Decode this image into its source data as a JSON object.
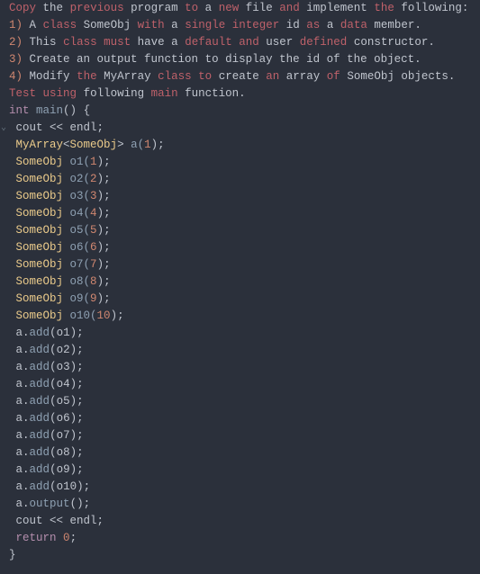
{
  "comment": {
    "line1": {
      "copy": "Copy",
      "the1": "the",
      "previous": "previous",
      "program": "program",
      "to": "to",
      "a1": "a",
      "new": "new",
      "file": "file",
      "and": "and",
      "implement": "implement",
      "the2": "the",
      "following": "following:"
    },
    "line2": {
      "num": "1)",
      "a": "A",
      "class": "class",
      "someobj": "SomeObj",
      "with": "with",
      "a2": "a",
      "single": "single",
      "integer": "integer",
      "id": "id",
      "as": "as",
      "a3": "a",
      "data": "data",
      "member": "member."
    },
    "line3": {
      "num": "2)",
      "this": "This",
      "class": "class",
      "must": "must",
      "have": "have",
      "a": "a",
      "default": "default",
      "and": "and",
      "user": "user",
      "defined": "defined",
      "constructor": "constructor."
    },
    "line4": {
      "num": "3)",
      "rest": "Create an output function to display the id of the object."
    },
    "line5": {
      "num": "4)",
      "modify": "Modify",
      "the": "the",
      "myarray": "MyArray",
      "class": "class",
      "to": "to",
      "create": "create",
      "an": "an",
      "array": "array",
      "of": "of",
      "someobj": "SomeObj",
      "objects": "objects."
    },
    "line6": {
      "test": "Test",
      "using": "using",
      "following": "following",
      "main": "main",
      "function": "function."
    }
  },
  "code": {
    "int": "int",
    "main": "main",
    "parens": "()",
    "lbrace": " {",
    "cout": "cout",
    "ll": " << ",
    "endl": "endl;",
    "myarray": "MyArray",
    "lt": "<",
    "someobj": "SomeObj",
    "gt": ">",
    "a_decl": " a(",
    "one": "1",
    "close_decl": ");",
    "obj_type": "SomeObj",
    "objs": [
      {
        "name": " o1(",
        "val": "1"
      },
      {
        "name": " o2(",
        "val": "2"
      },
      {
        "name": " o3(",
        "val": "3"
      },
      {
        "name": " o4(",
        "val": "4"
      },
      {
        "name": " o5(",
        "val": "5"
      },
      {
        "name": " o6(",
        "val": "6"
      },
      {
        "name": " o7(",
        "val": "7"
      },
      {
        "name": " o8(",
        "val": "8"
      },
      {
        "name": " o9(",
        "val": "9"
      },
      {
        "name": " o10(",
        "val": "10"
      }
    ],
    "close_obj": ");",
    "a": "a",
    "dot": ".",
    "add": "add",
    "open": "(",
    "adds": [
      "o1",
      "o2",
      "o3",
      "o4",
      "o5",
      "o6",
      "o7",
      "o8",
      "o9",
      "o10"
    ],
    "close_call": ");",
    "output": "output",
    "empty_call": "();",
    "return": "return",
    "sp": " ",
    "zero": "0",
    "semi": ";",
    "rbrace": "}"
  },
  "fold_glyph": "⌄"
}
